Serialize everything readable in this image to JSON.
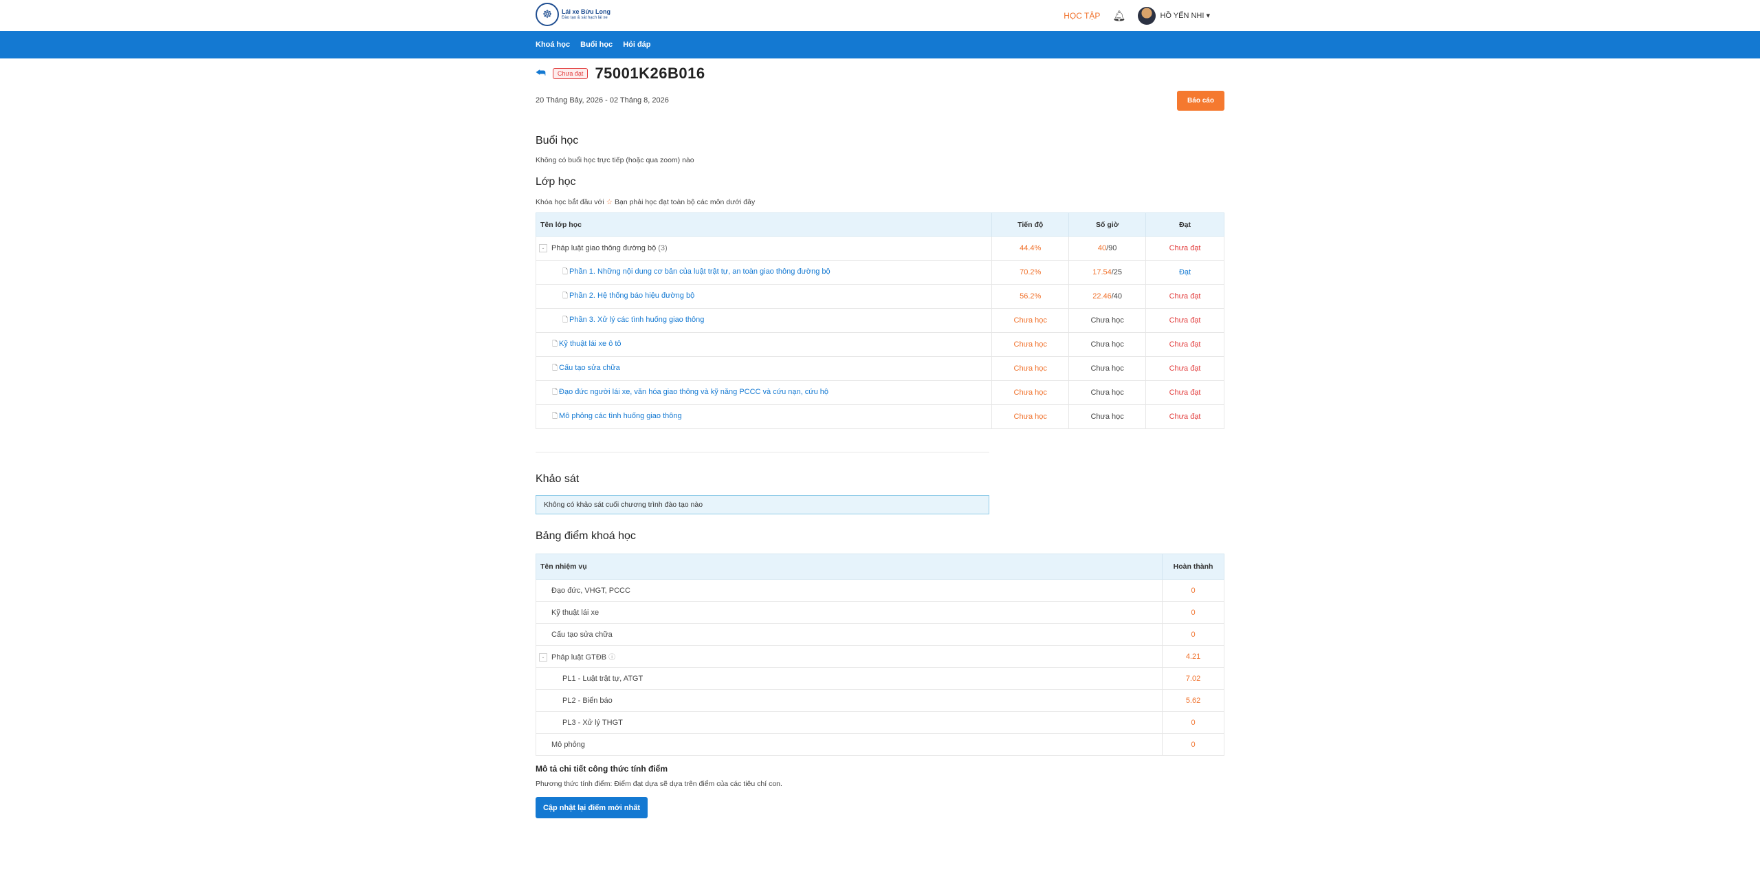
{
  "header": {
    "logo_title": "Lái xe Bửu Long",
    "logo_sub": "Đào tạo & sát hạch lái xe",
    "study_link": "HỌC TẬP",
    "user_name": "HỒ YẾN NHI ▾"
  },
  "nav": [
    "Khoá học",
    "Buổi học",
    "Hỏi đáp"
  ],
  "course": {
    "status_badge": "Chưa đạt",
    "code": "75001K26B016",
    "dates": "20 Tháng Bảy, 2026 - 02 Tháng 8, 2026",
    "report_button": "Báo cáo"
  },
  "sessions": {
    "title": "Buổi học",
    "note": "Không có buổi học trực tiếp (hoặc qua zoom) nào"
  },
  "classes": {
    "title": "Lớp học",
    "note_before": "Khóa học bắt đầu với",
    "note_after": "Bạn phải học đạt toàn bộ các môn dưới đây",
    "columns": [
      "Tên lớp học",
      "Tiến độ",
      "Số giờ",
      "Đạt"
    ],
    "rows": [
      {
        "name": "Pháp luật giao thông đường bộ",
        "count": "(3)",
        "progress": "44.4%",
        "hours_done": "40",
        "hours_total": "/90",
        "pass": "Chưa đạt"
      },
      {
        "name": "Phần 1. Những nội dung cơ bản của luật trật tự, an toàn giao thông đường bộ",
        "progress": "70.2%",
        "hours_done": "17.54",
        "hours_total": "/25",
        "pass": "Đạt"
      },
      {
        "name": "Phần 2. Hệ thống báo hiệu đường bộ",
        "progress": "56.2%",
        "hours_done": "22.46",
        "hours_total": "/40",
        "pass": "Chưa đạt"
      },
      {
        "name": "Phần 3. Xử lý các tình huống giao thông",
        "progress": "Chưa học",
        "hours_done": "Chưa học",
        "hours_total": "",
        "pass": "Chưa đạt"
      },
      {
        "name": "Kỹ thuật lái xe ô tô",
        "progress": "Chưa học",
        "hours_done": "Chưa học",
        "hours_total": "",
        "pass": "Chưa đạt"
      },
      {
        "name": "Cấu tạo sửa chữa",
        "progress": "Chưa học",
        "hours_done": "Chưa học",
        "hours_total": "",
        "pass": "Chưa đạt"
      },
      {
        "name": "Đạo đức người lái xe, văn hóa giao thông và kỹ năng PCCC và cứu nạn, cứu hộ",
        "progress": "Chưa học",
        "hours_done": "Chưa học",
        "hours_total": "",
        "pass": "Chưa đạt"
      },
      {
        "name": "Mô phỏng các tình huống giao thông",
        "progress": "Chưa học",
        "hours_done": "Chưa học",
        "hours_total": "",
        "pass": "Chưa đạt"
      }
    ]
  },
  "survey": {
    "title": "Khảo sát",
    "note": "Không có khảo sát cuối chương trình đào tạo nào"
  },
  "scores": {
    "title": "Bảng điểm khoá học",
    "columns": [
      "Tên nhiệm vụ",
      "Hoàn thành"
    ],
    "rows": [
      {
        "name": "Đạo đức, VHGT, PCCC",
        "value": "0"
      },
      {
        "name": "Kỹ thuật lái xe",
        "value": "0"
      },
      {
        "name": "Cấu tạo sửa chữa",
        "value": "0"
      },
      {
        "name": "Pháp luật GTĐB",
        "value": "4.21"
      },
      {
        "name": "PL1 - Luật trật tự, ATGT",
        "value": "7.02"
      },
      {
        "name": "PL2 - Biển báo",
        "value": "5.62"
      },
      {
        "name": "PL3 - Xử lý THGT",
        "value": "0"
      },
      {
        "name": "Mô phỏng",
        "value": "0"
      }
    ],
    "formula_title": "Mô tả chi tiết công thức tính điểm",
    "formula_desc": "Phương thức tính điểm: Điểm đạt dựa sẽ dựa trên điểm của các tiêu chí con.",
    "update_button": "Cập nhật lại điểm mới nhất"
  }
}
